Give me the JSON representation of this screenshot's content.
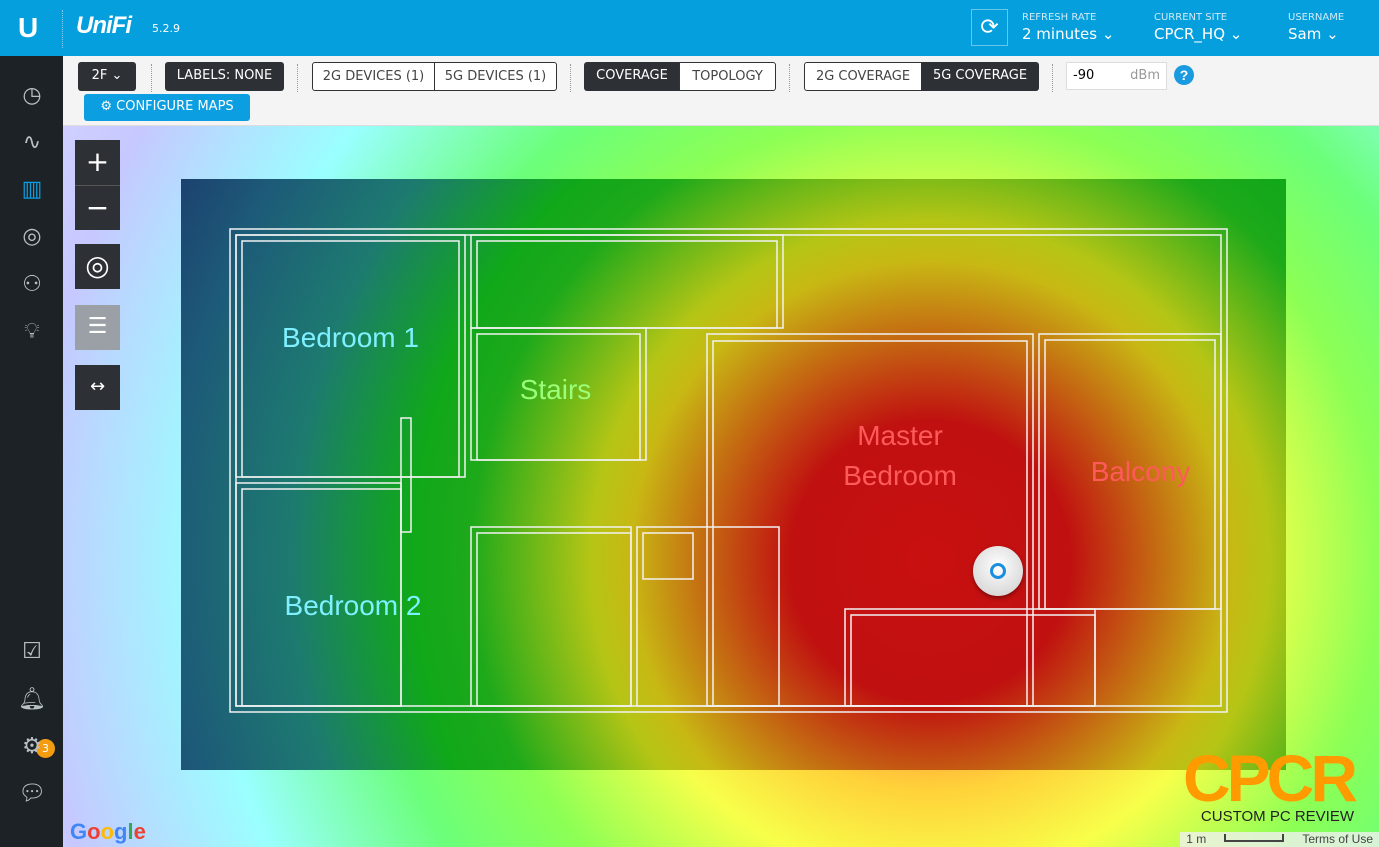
{
  "header": {
    "logo": "U",
    "brand": "UniFi",
    "version": "5.2.9",
    "refresh_rate": {
      "label": "REFRESH RATE",
      "value": "2 minutes"
    },
    "current_site": {
      "label": "CURRENT SITE",
      "value": "CPCR_HQ"
    },
    "username": {
      "label": "USERNAME",
      "value": "Sam"
    }
  },
  "sidebar": {
    "notification_count": "3",
    "items": [
      "dashboard",
      "statistics",
      "map",
      "devices",
      "clients",
      "insights",
      "events",
      "alerts",
      "settings",
      "chat"
    ]
  },
  "toolbar": {
    "floor": "2F",
    "labels": "LABELS: NONE",
    "devices_2g": "2G DEVICES (1)",
    "devices_5g": "5G DEVICES (1)",
    "coverage": "COVERAGE",
    "topology": "TOPOLOGY",
    "coverage_2g": "2G COVERAGE",
    "coverage_5g": "5G COVERAGE",
    "signal_value": "-90",
    "signal_unit": "dBm",
    "configure_maps": "CONFIGURE MAPS",
    "help": "?"
  },
  "map": {
    "rooms": [
      "Bedroom 1",
      "Stairs",
      "Master Bedroom",
      "Balcony",
      "Bedroom 2"
    ],
    "google": "Google",
    "watermark": "CPCR",
    "watermark_sub": "CUSTOM PC REVIEW",
    "scale": "1 m",
    "terms": "Terms of Use"
  },
  "colors": {
    "accent": "#069fdd",
    "sidebar": "#1c2226",
    "badge": "#f39c12"
  }
}
